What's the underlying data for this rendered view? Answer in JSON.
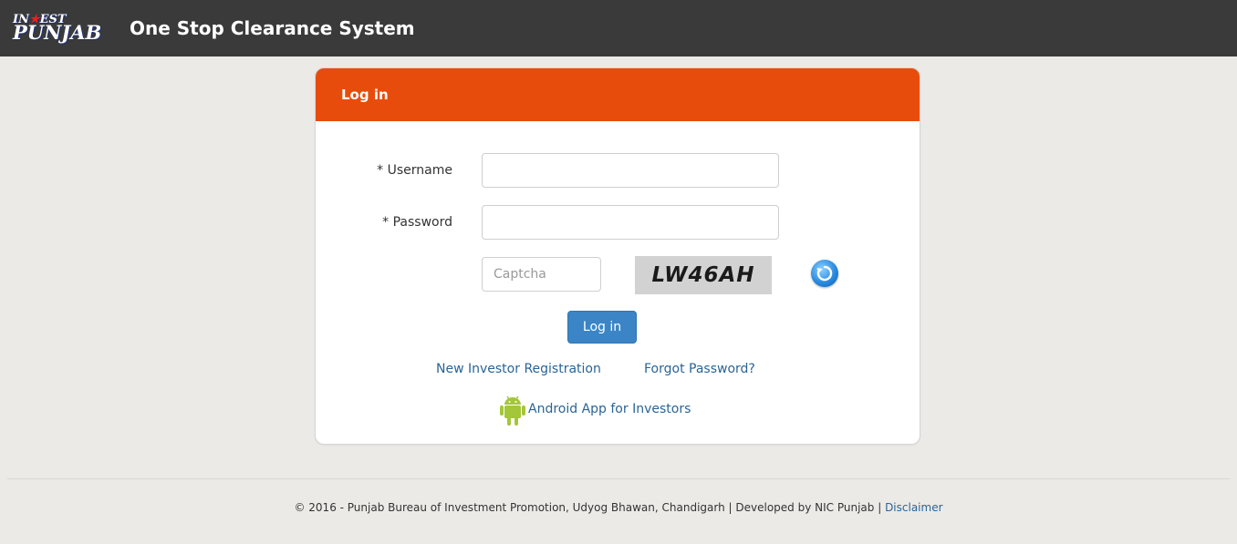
{
  "header": {
    "logo_line1_pre": "IN",
    "logo_line1_star": "★",
    "logo_line1_post": "EST",
    "logo_line2": "PUNJAB",
    "title": "One Stop Clearance System"
  },
  "login": {
    "heading": "Log in",
    "username_label": "* Username",
    "username_value": "",
    "password_label": "* Password",
    "password_value": "",
    "captcha_placeholder": "Captcha",
    "captcha_text": "LW46AH",
    "refresh_icon": "refresh-icon",
    "submit_label": "Log in",
    "register_link": "New Investor Registration",
    "forgot_link": "Forgot Password?",
    "android_link": "Android App for Investors",
    "android_icon": "android-icon"
  },
  "footer": {
    "text": "© 2016 - Punjab Bureau of Investment Promotion, Udyog Bhawan, Chandigarh | Developed by NIC Punjab | ",
    "disclaimer_link": "Disclaimer"
  },
  "colors": {
    "topbar": "#3a3a3a",
    "panel_header": "#e84c0c",
    "primary_button": "#3b85c6",
    "link": "#2a6496",
    "android_green": "#a4c639"
  }
}
